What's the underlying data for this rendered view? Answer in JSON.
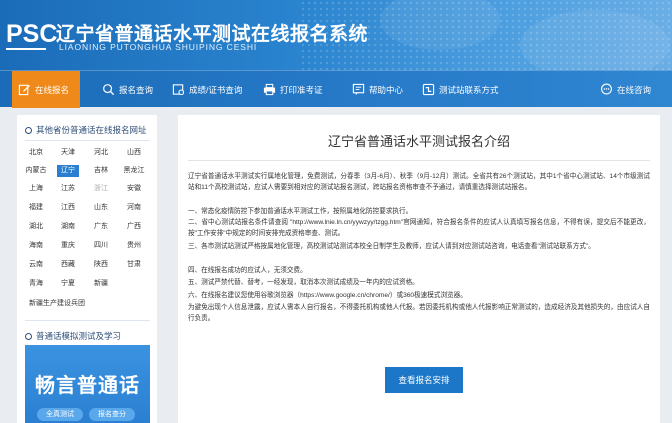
{
  "header": {
    "logo": "PSC",
    "title": "辽宁省普通话水平测试在线报名系统",
    "subtitle": "LIAONING PUTONGHUA SHUIPING CESHI"
  },
  "nav": {
    "items": [
      {
        "label": "在线报名",
        "icon": "edit-icon",
        "active": true
      },
      {
        "label": "报名查询",
        "icon": "search-icon"
      },
      {
        "label": "成绩/证书查询",
        "icon": "certificate-icon"
      },
      {
        "label": "打印准考证",
        "icon": "printer-icon"
      },
      {
        "label": "帮助中心",
        "icon": "help-icon"
      },
      {
        "label": "测试站联系方式",
        "icon": "contact-icon"
      },
      {
        "label": "在线咨询",
        "icon": "chat-icon"
      }
    ]
  },
  "sidebar": {
    "provinces_heading": "其他省份普通话在线报名网址",
    "provinces": [
      [
        "北京",
        "天津",
        "河北",
        "山西"
      ],
      [
        "内蒙古",
        "辽宁",
        "吉林",
        "黑龙江"
      ],
      [
        "上海",
        "江苏",
        "浙江",
        "安徽"
      ],
      [
        "福建",
        "江西",
        "山东",
        "河南"
      ],
      [
        "湖北",
        "湖南",
        "广东",
        "广西"
      ],
      [
        "海南",
        "重庆",
        "四川",
        "贵州"
      ],
      [
        "云南",
        "西藏",
        "陕西",
        "甘肃"
      ],
      [
        "青海",
        "宁夏",
        "新疆"
      ]
    ],
    "selected_province": "辽宁",
    "dimmed_province": "浙江",
    "extra_link": "新疆生产建设兵团",
    "practice_heading": "普通话模拟测试及学习",
    "promo": {
      "title": "畅言普通话",
      "button1": "全真测试",
      "button2": "报名查分"
    }
  },
  "main": {
    "title": "辽宁省普通话水平测试报名介绍",
    "paragraphs": [
      "辽宁省普通话水平测试实行属地化管理，免费测试，分春季（3月-6月）、秋季（9月-12月）测试。全省共有26个测试站，其中1个省中心测试站、14个市级测试站和11个高校测试站，应试人需要到相对应的测试站报名测试，跨站报名资格审查不予通过，请慎重选择测试站报名。",
      "一、常态化疫情防控下参加普通话水平测试工作，按照属地化防控要求执行。",
      "二、省中心测试站报名条件请查阅 \"http://www.lnie.ln.cn/yywzyy/tzgg.htm\"官网通知，符合报名条件的应试人认真填写报名信息，不得有误，提交后不能更改，按\"工作安排\"中规定的时间安排完成资格审查、测试。",
      "三、各市测试站测试严格按属地化管理，高校测试站测试本校全日制学生及教师，应试人请到对应测试站咨询，电话查看\"测试站联系方式\"。",
      "四、在线报名成功的应试人，无须交费。",
      "五、测试严禁代替、替考，一经发现，取消本次测试成绩及一年内的应试资格。",
      "六、在线报名建议您使用谷歌浏览器（https://www.google.cn/chrome/）或360极速模式浏览器。",
      "为避免出现个人信息泄露，应试人需本人自行报名，不得委托机构或他人代报。若因委托机构或他人代报影响正常测试的，造成经济及其他损失的，由应试人自行负责。"
    ],
    "cta_label": "查看报名安排"
  }
}
